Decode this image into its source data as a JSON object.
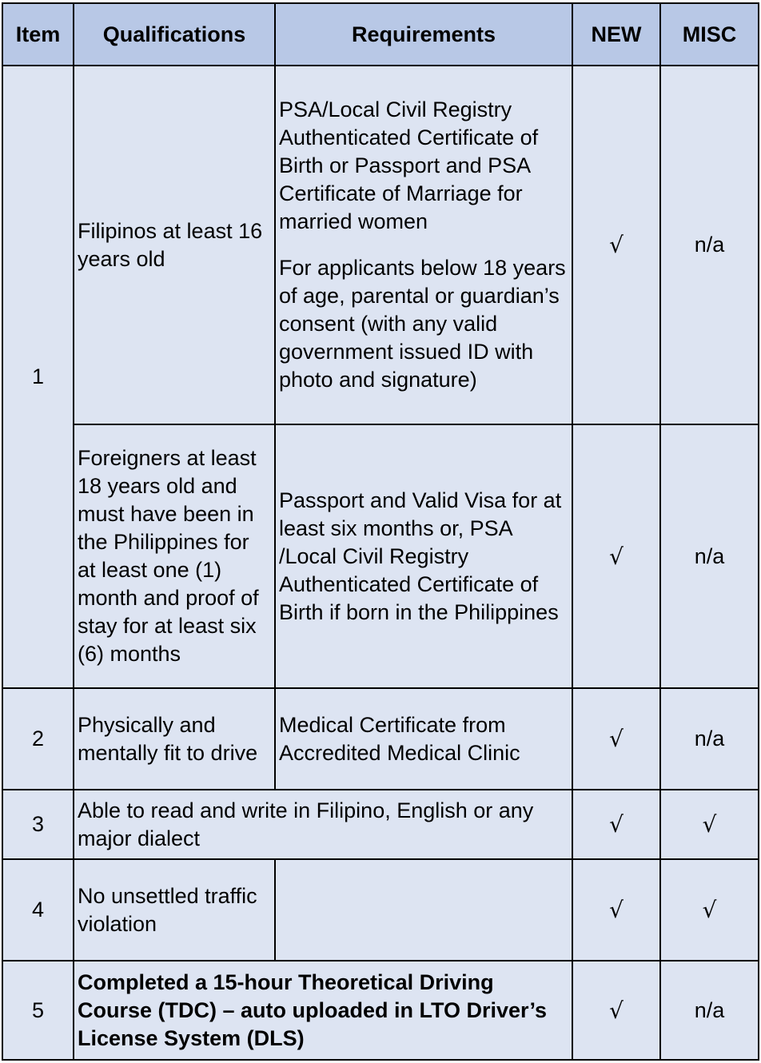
{
  "headers": {
    "item": "Item",
    "qualifications": "Qualifications",
    "requirements": "Requirements",
    "new": "NEW",
    "misc": "MISC"
  },
  "rows": [
    {
      "item": "1",
      "sub": [
        {
          "qualification": "Filipinos at least 16 years old",
          "requirements": [
            "PSA/Local Civil Registry Authenticated Certificate of Birth or Passport and PSA Certificate of Marriage for married women",
            "For applicants below 18 years of age, parental or guardian’s consent (with any valid government issued ID with photo and signature)"
          ],
          "new": "√",
          "misc": "n/a"
        },
        {
          "qualification": "Foreigners at least 18 years old and must have been in the Philippines for at least one (1) month and proof of stay for at least six (6) months",
          "requirements": [
            "Passport and Valid Visa for at least six months or, PSA /Local Civil Registry Authenticated Certificate of Birth if born in the Philippines"
          ],
          "new": "√",
          "misc": "n/a"
        }
      ]
    },
    {
      "item": "2",
      "qualification": "Physically and mentally fit to drive",
      "requirement": "Medical Certificate from Accredited Medical Clinic",
      "new": "√",
      "misc": "n/a"
    },
    {
      "item": "3",
      "qualification": "Able to read and write in Filipino, English or any major dialect",
      "new": "√",
      "misc": "√"
    },
    {
      "item": "4",
      "qualification": "No unsettled traffic violation",
      "requirement": "",
      "new": "√",
      "misc": "√"
    },
    {
      "item": "5",
      "qualification": "Completed a 15-hour Theoretical Driving Course (TDC) – auto uploaded in LTO Driver’s License System (DLS)",
      "new": "√",
      "misc": "n/a"
    }
  ]
}
